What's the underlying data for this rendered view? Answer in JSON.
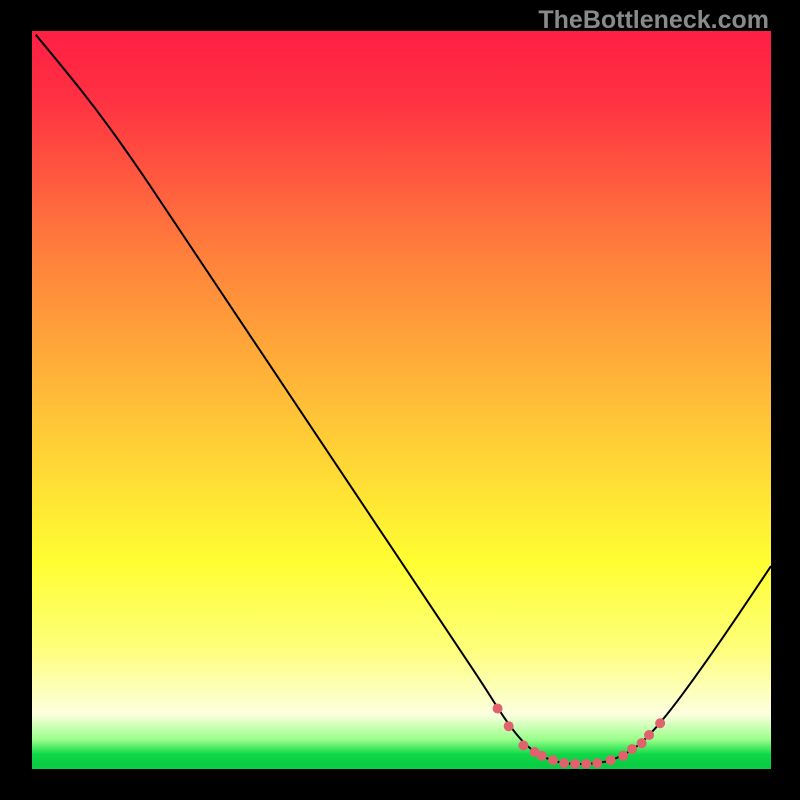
{
  "watermark": "TheBottleneck.com",
  "chart_data": {
    "type": "line",
    "title": "",
    "xlabel": "",
    "ylabel": "",
    "xlim": [
      0,
      100
    ],
    "ylim": [
      0,
      100
    ],
    "background_gradient": {
      "stops": [
        {
          "offset": 0.0,
          "color": "#ff1f44"
        },
        {
          "offset": 0.09,
          "color": "#ff3042"
        },
        {
          "offset": 0.3,
          "color": "#ff7f3c"
        },
        {
          "offset": 0.52,
          "color": "#ffc337"
        },
        {
          "offset": 0.72,
          "color": "#fffe32"
        },
        {
          "offset": 0.84,
          "color": "#feff7d"
        },
        {
          "offset": 0.926,
          "color": "#fcffdf"
        },
        {
          "offset": 0.96,
          "color": "#9aff8b"
        },
        {
          "offset": 0.98,
          "color": "#0fd947"
        },
        {
          "offset": 0.992,
          "color": "#0acd44"
        },
        {
          "offset": 1.0,
          "color": "#0acd44"
        }
      ]
    },
    "curve": {
      "color": "#000000",
      "width": 2,
      "points_xy": [
        [
          0.5,
          99.5
        ],
        [
          4.0,
          95.3
        ],
        [
          9.0,
          89.0
        ],
        [
          14.0,
          82.0
        ],
        [
          20.0,
          73.0
        ],
        [
          28.0,
          61.0
        ],
        [
          36.0,
          49.0
        ],
        [
          44.0,
          37.0
        ],
        [
          52.0,
          25.0
        ],
        [
          58.0,
          16.0
        ],
        [
          61.0,
          11.5
        ],
        [
          63.5,
          7.5
        ],
        [
          65.5,
          4.7
        ],
        [
          67.5,
          2.6
        ],
        [
          70.0,
          1.2
        ],
        [
          73.0,
          0.6
        ],
        [
          77.0,
          0.8
        ],
        [
          79.0,
          1.4
        ],
        [
          81.0,
          2.4
        ],
        [
          83.0,
          4.0
        ],
        [
          86.0,
          7.4
        ],
        [
          90.0,
          12.8
        ],
        [
          95.0,
          20.0
        ],
        [
          100.0,
          27.5
        ]
      ]
    },
    "dots": {
      "color": "#e0626c",
      "radius": 5,
      "points_xy": [
        [
          63.0,
          8.2
        ],
        [
          64.5,
          5.8
        ],
        [
          66.5,
          3.2
        ],
        [
          68.0,
          2.3
        ],
        [
          69.0,
          1.8
        ],
        [
          70.5,
          1.2
        ],
        [
          72.0,
          0.8
        ],
        [
          73.5,
          0.7
        ],
        [
          75.0,
          0.7
        ],
        [
          76.5,
          0.8
        ],
        [
          78.3,
          1.2
        ],
        [
          80.0,
          1.8
        ],
        [
          81.2,
          2.7
        ],
        [
          82.5,
          3.5
        ],
        [
          83.5,
          4.6
        ],
        [
          85.0,
          6.2
        ]
      ]
    }
  }
}
